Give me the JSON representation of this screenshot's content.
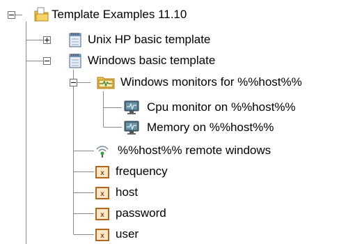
{
  "tree": {
    "root": {
      "label": "Template Examples 11.10",
      "expanded": true,
      "icon": "folder-template-icon"
    },
    "items": [
      {
        "label": "Unix HP basic template",
        "expanded": false,
        "icon": "template-document-icon"
      },
      {
        "label": "Windows basic template",
        "expanded": true,
        "icon": "template-document-icon"
      },
      {
        "label": "Windows monitors for %%host%%",
        "expanded": true,
        "icon": "monitor-group-icon"
      },
      {
        "label": "Cpu monitor on %%host%%",
        "icon": "monitor-icon"
      },
      {
        "label": "Memory on %%host%%",
        "icon": "monitor-icon"
      },
      {
        "label": "%%host%% remote windows",
        "icon": "remote-connection-icon"
      },
      {
        "label": "frequency",
        "icon": "variable-icon"
      },
      {
        "label": "host",
        "icon": "variable-icon"
      },
      {
        "label": "password",
        "icon": "variable-icon"
      },
      {
        "label": "user",
        "icon": "variable-icon"
      }
    ]
  },
  "colors": {
    "connector": "#888888",
    "folder": "#f3c24a",
    "variable_border": "#b5661e",
    "monitor_screen": "#4a6e7e"
  }
}
